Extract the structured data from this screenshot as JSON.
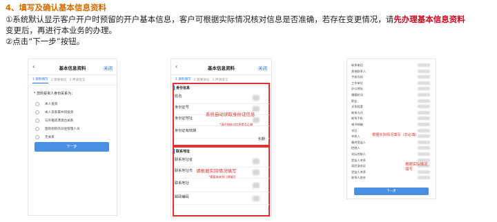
{
  "header": {
    "title": "4、填写及确认基本信息资料",
    "line1_pre": "①系统默认显示客户开户时预留的开户基本信息，客户可根据实际情况核对信息是否准确，若存在变更情况，请",
    "line1_highlight": "先办理基本信息资料",
    "line1_post": "变更后，再进行本业务的办理。",
    "line2": "②点击“下一步”按钮。"
  },
  "colors": {
    "accent": "#1e74e8",
    "highlight": "#d0021b",
    "title": "#d46b00",
    "annotation": "#e03030"
  },
  "phone1": {
    "back_icon": "chevron-left-icon",
    "title": "基本信息资料",
    "close": "关闭",
    "steps": [
      "1.资料填写",
      "2.需要协议",
      "3.申请提交"
    ],
    "question": "* 您的投资人身份关系为：",
    "options": [
      "本人投资",
      "本人及家属共同投资",
      "与外籍或港澳台关系",
      "国际组织的派驻管理人员",
      "无关系"
    ],
    "next": "下一步"
  },
  "phone2": {
    "back_icon": "chevron-left-icon",
    "title": "基本信息资料",
    "close": "关闭",
    "steps": [
      "1.资料填写",
      "2.需要协议",
      "3.申请提交"
    ],
    "section1": "身份信息",
    "fields1": [
      "姓名",
      "身份证号",
      "身份证地址",
      "身份证有效期"
    ],
    "annotation1": "系统自动读取身份证信息",
    "note1": "*请仔细核对信息是否正确",
    "suffix_longterm": "长期",
    "section2": "联系地址",
    "fields2": [
      "联系地址省",
      "联系地址市",
      "联系地址",
      "邮政编码"
    ],
    "annotation2": "请根据实际情况填写",
    "note2": "*需要具体到门牌编号"
  },
  "phone3": {
    "fields": [
      "联系电话",
      "其他联系人",
      "手机号码",
      "工作单位",
      "办公地址",
      "婚姻状况",
      "职业",
      "文化程度",
      "联系方式",
      "联系手机",
      "电子邮箱",
      "学历",
      "年收入",
      "最终受益人",
      "控制人",
      "实际控制人",
      "受益人关系",
      "居民身份证",
      "受益人关系",
      "联系人姓名"
    ],
    "annotation1": "根据实际情况填写（非必填）",
    "annotation2": "根据实际情况\n填写",
    "next": "下一步"
  }
}
